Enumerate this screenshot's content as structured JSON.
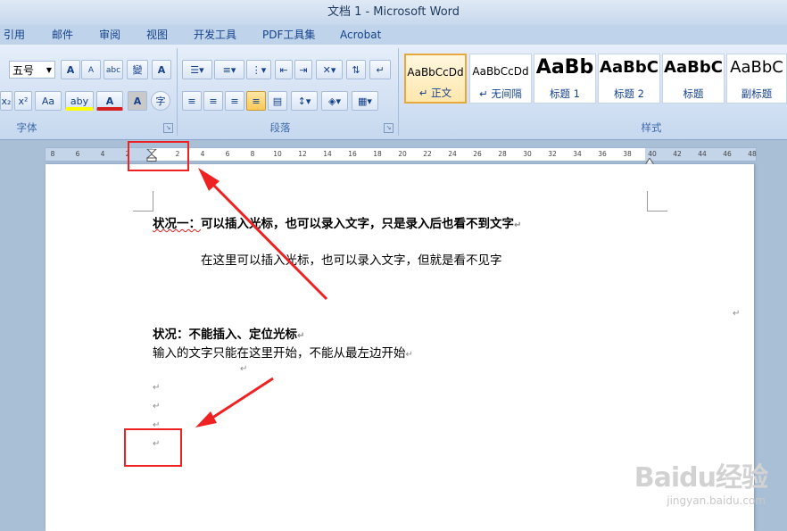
{
  "window": {
    "title": "文档 1 - Microsoft Word"
  },
  "tabs": [
    "引用",
    "邮件",
    "审阅",
    "视图",
    "开发工具",
    "PDF工具集",
    "Acrobat"
  ],
  "ribbon": {
    "font": {
      "size_value": "五号",
      "group_label": "字体",
      "buttons": [
        "A",
        "A",
        "abc",
        "變",
        "A",
        "x₂",
        "x²",
        "Aa",
        "aby",
        "A",
        "A",
        "字"
      ]
    },
    "paragraph": {
      "group_label": "段落"
    },
    "styles": {
      "group_label": "样式",
      "tiles": [
        {
          "sample": "AaBbCcDd",
          "name": "↵ 正文"
        },
        {
          "sample": "AaBbCcDd",
          "name": "↵ 无间隔"
        },
        {
          "sample": "AaBb",
          "name": "标题 1"
        },
        {
          "sample": "AaBbC",
          "name": "标题 2"
        },
        {
          "sample": "AaBbC",
          "name": "标题"
        },
        {
          "sample": "AaBbC",
          "name": "副标题"
        }
      ]
    }
  },
  "ruler": {
    "ticks": [
      "8",
      "6",
      "4",
      "2",
      "",
      "2",
      "4",
      "6",
      "8",
      "10",
      "12",
      "14",
      "16",
      "18",
      "20",
      "22",
      "24",
      "26",
      "28",
      "30",
      "32",
      "34",
      "36",
      "38",
      "40",
      "42",
      "44",
      "46",
      "48"
    ]
  },
  "document": {
    "heading1_prefix": "状况一：",
    "heading1_text": "可以插入光标，也可以录入文字，只是录入后也看不到文字",
    "line1": "在这里可以插入光标，也可以录入文字，但就是看不见字",
    "heading2": "状况：不能插入、定位光标",
    "line2": "输入的文字只能在这里开始，不能从最左边开始",
    "para_mark": "↵"
  },
  "watermark": {
    "brand": "Baidu经验",
    "url": "jingyan.baidu.com"
  },
  "colors": {
    "annotation_red": "#ee2222",
    "ribbon_blue": "#15428b"
  }
}
